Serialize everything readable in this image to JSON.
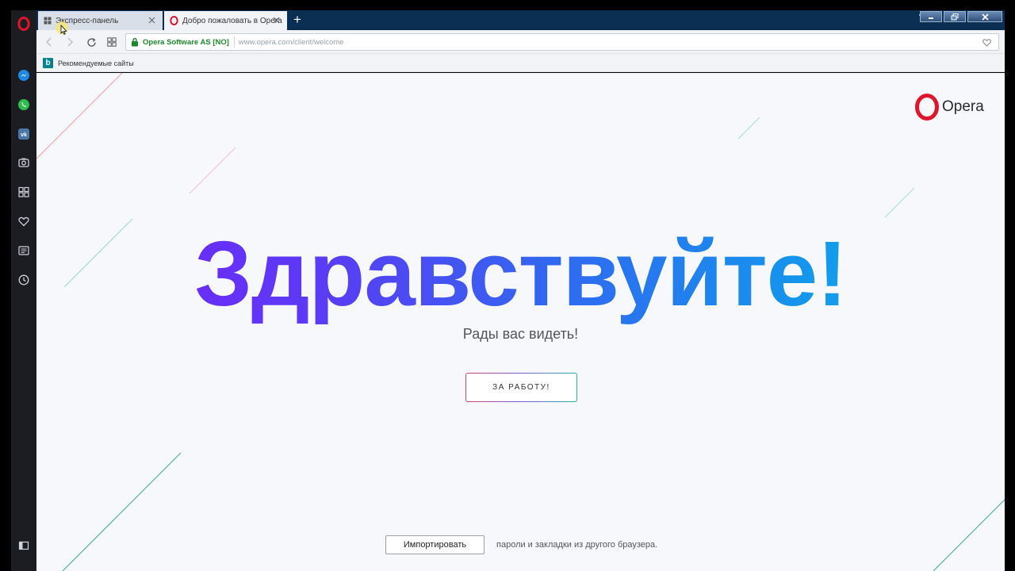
{
  "tabs": [
    {
      "label": "Экспресс-панель",
      "icon": "speed-dial-icon",
      "active": false
    },
    {
      "label": "Добро пожаловать в Opera",
      "icon": "opera-icon",
      "active": true
    }
  ],
  "address": {
    "certificate": "Opera Software AS [NO]",
    "url": "www.opera.com/client/welcome"
  },
  "bookmarks": [
    {
      "label": "Рекомендуемые сайты",
      "icon": "bing-icon",
      "icon_glyph": "b"
    }
  ],
  "page": {
    "logo_text": "Opera",
    "headline": "Здравствуйте!",
    "subtitle": "Рады вас видеть!",
    "start_button": "ЗА РАБОТУ!",
    "import_button": "Импортировать",
    "import_description": "пароли и закладки из другого браузера."
  },
  "sidebar": {
    "items": [
      "opera-menu-icon",
      "messenger-icon",
      "whatsapp-icon",
      "vk-icon",
      "snapshot-icon",
      "speed-dial-icon",
      "bookmarks-heart-icon",
      "news-icon",
      "history-icon",
      "sidebar-toggle-icon"
    ]
  },
  "colors": {
    "opera_red": "#e0142b",
    "tabbar": "#0b2f53",
    "sidebar": "#1b1d22",
    "headline_gradient": [
      "#7a1dff",
      "#10b8e8"
    ]
  }
}
